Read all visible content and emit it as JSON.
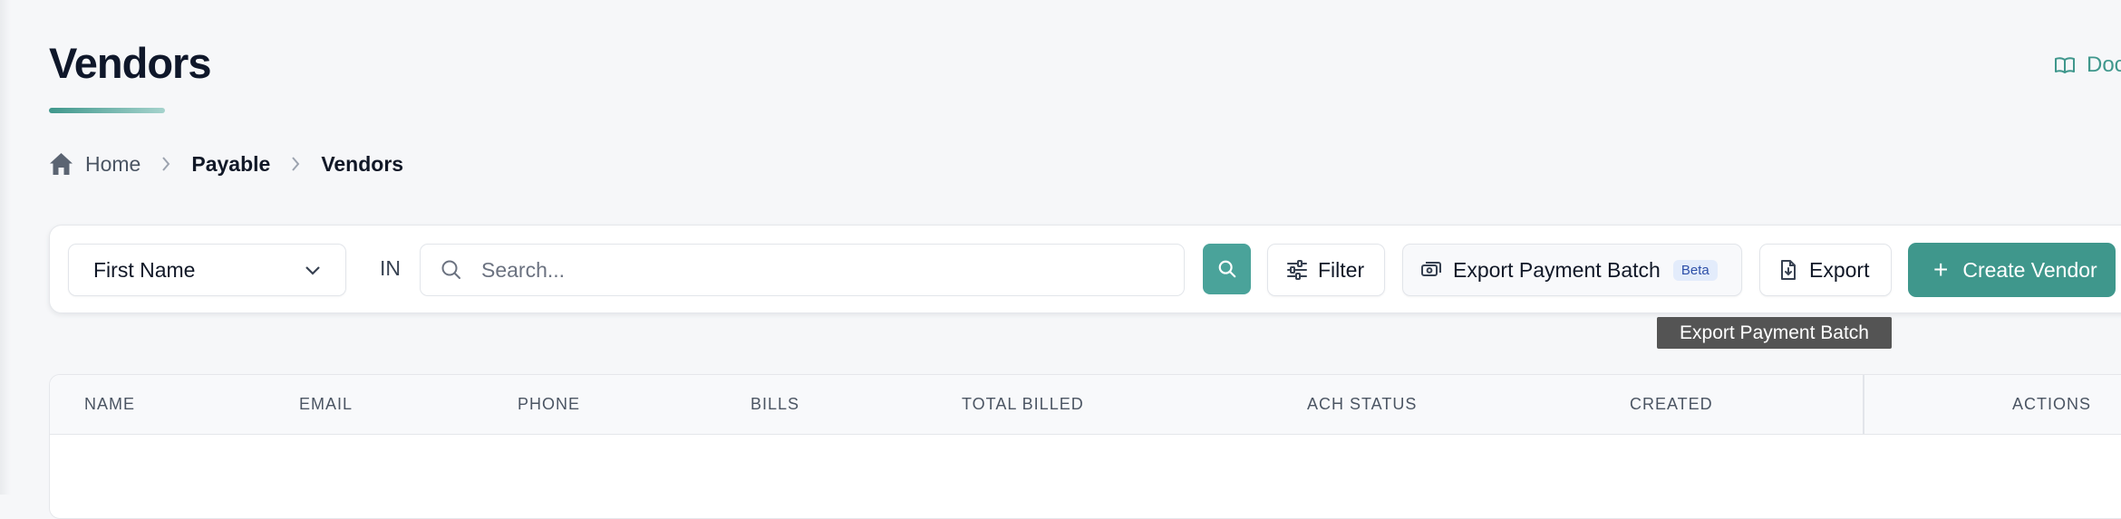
{
  "page": {
    "title": "Vendors",
    "docs_label": "Doc"
  },
  "breadcrumb": {
    "home": "Home",
    "payable": "Payable",
    "current": "Vendors"
  },
  "toolbar": {
    "field_select": "First Name",
    "in_label": "IN",
    "search_placeholder": "Search...",
    "filter_label": "Filter",
    "export_batch_label": "Export Payment Batch",
    "beta_label": "Beta",
    "export_label": "Export",
    "create_label": "Create Vendor",
    "accent_color": "#3f978c"
  },
  "tooltip": {
    "text": "Export Payment Batch"
  },
  "table": {
    "columns": [
      "NAME",
      "EMAIL",
      "PHONE",
      "BILLS",
      "TOTAL BILLED",
      "ACH STATUS",
      "CREATED",
      "ACTIONS"
    ]
  },
  "icons": {
    "docs": "book-open-icon",
    "home": "home-icon",
    "chevron": "chevron-right-icon",
    "select": "chevron-down-icon",
    "search": "search-icon",
    "filter": "sliders-icon",
    "batch": "cash-icon",
    "export": "file-download-icon",
    "create": "plus-icon"
  }
}
